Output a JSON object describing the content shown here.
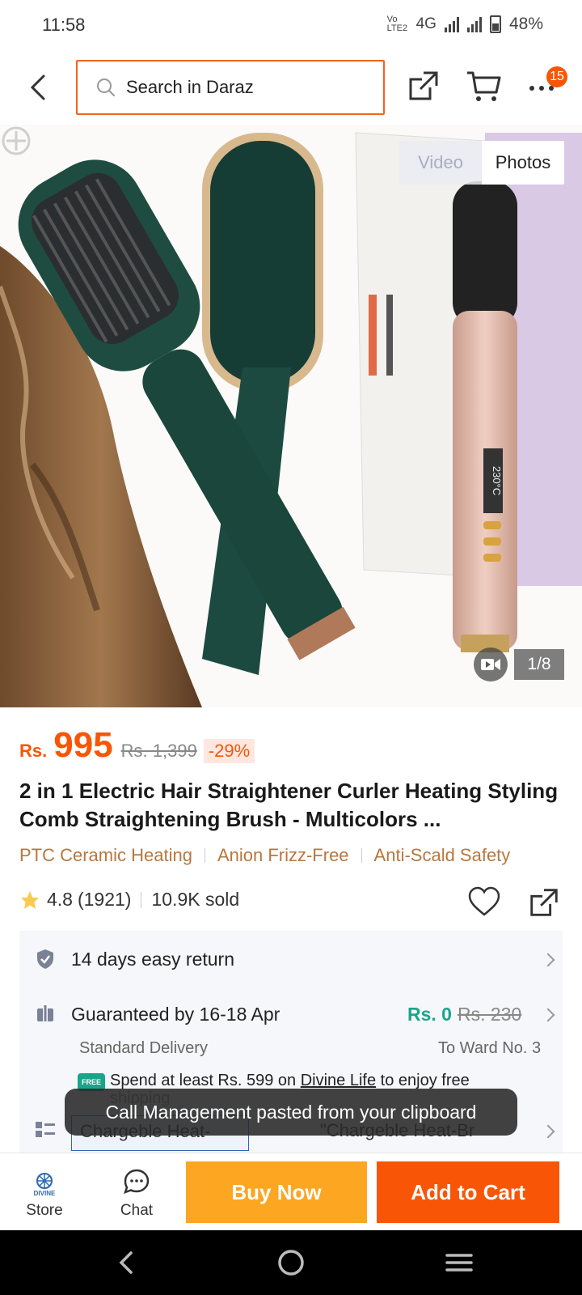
{
  "status_bar": {
    "time": "11:58",
    "network_label": "Vo LTE2",
    "network_type": "4G",
    "battery": "48%"
  },
  "top_nav": {
    "search_placeholder": "Search in Daraz",
    "cart_badge": "15"
  },
  "gallery": {
    "tab_video": "Video",
    "tab_photos": "Photos",
    "counter": "1/8",
    "device_display": "230°C",
    "active_color": "#212121",
    "inactive_color": "#a9aec0"
  },
  "price": {
    "currency": "Rs.",
    "current": "995",
    "original": "Rs. 1,399",
    "discount": "-29%"
  },
  "product": {
    "title": "2 in 1 Electric Hair Straightener Curler Heating Styling Comb Straightening Brush - Multicolors ...",
    "tags": [
      "PTC Ceramic Heating",
      "Anion Frizz-Free",
      "Anti-Scald Safety"
    ],
    "rating": "4.8",
    "rating_count": "(1921)",
    "sold": "10.9K sold"
  },
  "services": {
    "returns": "14 days easy return",
    "delivery_title": "Guaranteed by 16-18 Apr",
    "delivery_type": "Standard Delivery",
    "delivery_price": "Rs. 0",
    "delivery_old_price": "Rs. 230",
    "delivery_location": "To Ward No. 3",
    "free_tag": "FREE",
    "promo_prefix": "Spend at least Rs. 599 on ",
    "promo_store": "Divine Life",
    "promo_suffix": " to enjoy free",
    "promo_line2": "shipping",
    "variant_box": "Chargeble Heat-",
    "variant_text": "\"Chargeble Heat-Br"
  },
  "toast": "Call Management pasted from your clipboard",
  "bottom_bar": {
    "store_logo": "DIVINE",
    "store_label": "Store",
    "chat_label": "Chat",
    "buy_now": "Buy Now",
    "add_to_cart": "Add to Cart",
    "buy_color": "#fca622",
    "cart_color": "#f85606"
  }
}
